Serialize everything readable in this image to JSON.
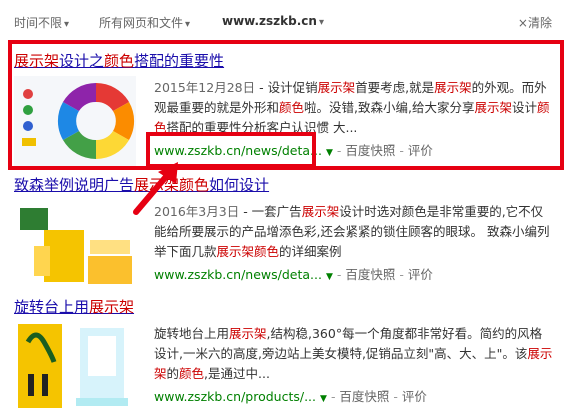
{
  "filters": {
    "time": "时间不限",
    "type": "所有网页和文件",
    "site": "www.zszkb.cn",
    "clear": "清除",
    "clear_icon": "close-icon"
  },
  "results": [
    {
      "title_pre": "",
      "title_hl1": "展示架",
      "title_mid": "设计之",
      "title_hl2": "颜色",
      "title_post": "搭配的重要性",
      "thumb_label": "色相环",
      "date": "2015年12月28日",
      "s1_a": " - 设计促销",
      "s1_hl1": "展示架",
      "s1_b": "首要考虑,就是",
      "s1_hl2": "展示架",
      "s1_c": "的外观。而外",
      "s2_a": "观最重要的就是外形和",
      "s2_hl": "颜色",
      "s2_b": "啦。没错,致森小编,给大家分享",
      "s2_hl2": "展示架",
      "s2_c": "设",
      "s3_a": "计",
      "s3_hl": "颜色",
      "s3_b": "搭配的重要性分析客户认识惯 大...",
      "url": "www.zszkb.cn/news/deta...",
      "cache": "百度快照",
      "review": "评价"
    },
    {
      "title_pre": "致森举例说明广告",
      "title_hl1": "展示架",
      "title_mid": "",
      "title_hl2": "颜色",
      "title_post": "如何设计",
      "date": "2016年3月3日",
      "s1_a": " - 一套广告",
      "s1_hl1": "展示架",
      "s1_b": "设计时选对颜色是非常重要的,它不仅",
      "s2_a": "能给所要展示的产品增添色彩,还会紧紧的锁住顾客的眼球。 致森小",
      "s3_a": "编列举下面几款",
      "s3_hl1": "展示架",
      "s3_hl2": "颜色",
      "s3_b": "的详细案例",
      "url": "www.zszkb.cn/news/deta...",
      "cache": "百度快照",
      "review": "评价"
    },
    {
      "title_pre": "旋转台上用",
      "title_hl1": "展示架",
      "date": "",
      "s1_a": "旋转地台上用",
      "s1_hl1": "展示架",
      "s1_b": ",结构稳,360°每一个角度都非常好看。简约的风",
      "s2_a": "格设计,一米六的高度,旁边站上美女模特,促销品立刻\"高、大、上\"。该",
      "s3_hl1": "展示架",
      "s3_a": "的",
      "s3_hl2": "颜色",
      "s3_b": ",是通过中...",
      "url": "www.zszkb.cn/products/...",
      "cache": "百度快照",
      "review": "评价"
    }
  ],
  "colors": {
    "annotation": "#e60012",
    "title_link": "#1a0dab",
    "highlight": "#cc0000",
    "url": "#008000"
  }
}
